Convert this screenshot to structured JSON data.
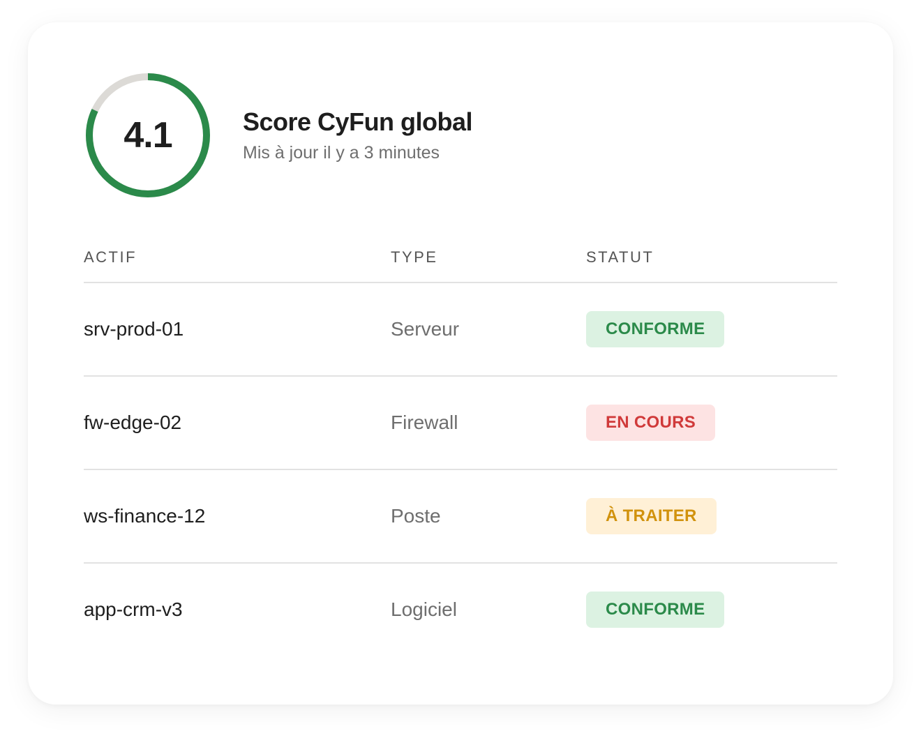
{
  "score": {
    "value": "4.1",
    "ratio": 0.82,
    "title": "Score CyFun global",
    "subtitle": "Mis à jour il y a 3 minutes",
    "colors": {
      "progress": "#2b8a4a",
      "track": "#dcdad6"
    }
  },
  "table": {
    "headers": {
      "asset": "ACTIF",
      "type": "TYPE",
      "status": "STATUT"
    },
    "rows": [
      {
        "asset": "srv-prod-01",
        "type": "Serveur",
        "status": "CONFORME"
      },
      {
        "asset": "fw-edge-02",
        "type": "Firewall",
        "status": "EN COURS"
      },
      {
        "asset": "ws-finance-12",
        "type": "Poste",
        "status": "À TRAITER"
      },
      {
        "asset": "app-crm-v3",
        "type": "Logiciel",
        "status": "CONFORME"
      }
    ]
  },
  "status_colors": {
    "conforme": {
      "bg": "#dcf2e2",
      "fg": "#2b8a4a"
    },
    "en_cours": {
      "bg": "#fde3e3",
      "fg": "#d03a3a"
    },
    "a_traiter": {
      "bg": "#fff0d6",
      "fg": "#d1920d"
    }
  }
}
